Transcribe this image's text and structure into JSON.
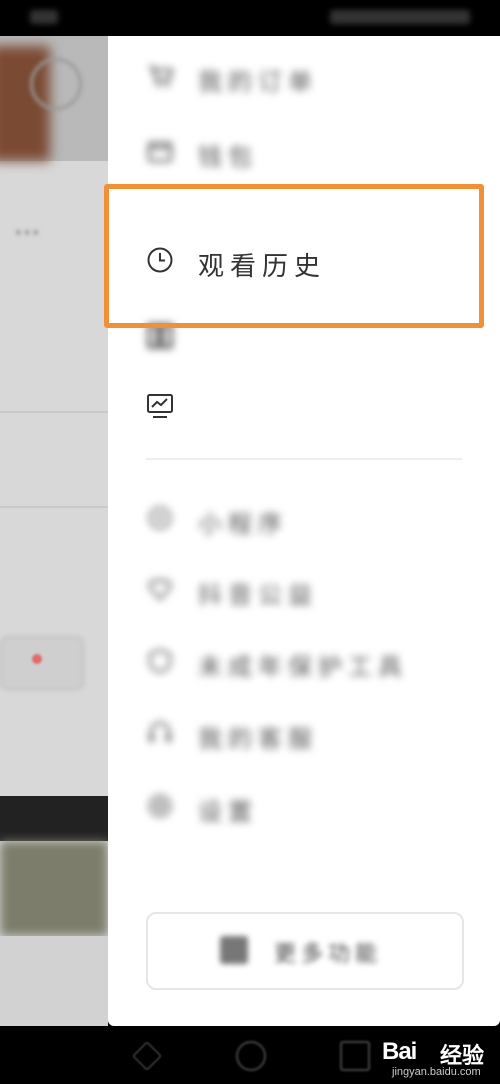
{
  "drawer": {
    "items": [
      {
        "label": "我的订单",
        "icon": "cart-icon"
      },
      {
        "label": "钱包",
        "icon": "wallet-icon"
      },
      {
        "label": "观看历史",
        "icon": "clock-icon"
      },
      {
        "label": "",
        "icon": "creator-icon"
      },
      {
        "label": "",
        "icon": "monitor-icon"
      },
      {
        "label": "小程序",
        "icon": "miniprogram-icon"
      },
      {
        "label": "抖音公益",
        "icon": "heart-icon"
      },
      {
        "label": "未成年保护工具",
        "icon": "shield-icon"
      },
      {
        "label": "我的客服",
        "icon": "headset-icon"
      },
      {
        "label": "设置",
        "icon": "settings-icon"
      }
    ],
    "more_button": {
      "label": "更多功能",
      "icon": "grid-icon"
    }
  },
  "highlight": {
    "color": "#f0913a"
  },
  "watermark": {
    "brand": "Bai",
    "cn": "经验",
    "url": "jingyan.baidu.com"
  }
}
